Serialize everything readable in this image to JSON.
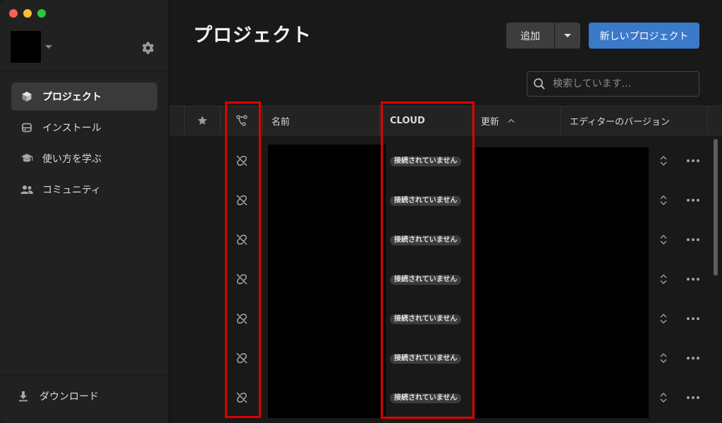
{
  "sidebar": {
    "settings_icon": "gear-icon",
    "nav": [
      {
        "label": "プロジェクト",
        "icon": "cube-icon",
        "active": true
      },
      {
        "label": "インストール",
        "icon": "installs-icon",
        "active": false
      },
      {
        "label": "使い方を学ぶ",
        "icon": "graduation-cap-icon",
        "active": false
      },
      {
        "label": "コミュニティ",
        "icon": "people-icon",
        "active": false
      }
    ],
    "download_label": "ダウンロード"
  },
  "main": {
    "title": "プロジェクト",
    "add_button": "追加",
    "new_project_button": "新しいプロジェクト",
    "search_placeholder": "検索しています...",
    "columns": {
      "name": "名前",
      "cloud": "CLOUD",
      "updated": "更新",
      "editor_version": "エディターのバージョン"
    },
    "rows": [
      {
        "cloud_status": "接続されていません"
      },
      {
        "cloud_status": "接続されていません"
      },
      {
        "cloud_status": "接続されていません"
      },
      {
        "cloud_status": "接続されていません"
      },
      {
        "cloud_status": "接続されていません"
      },
      {
        "cloud_status": "接続されていません"
      },
      {
        "cloud_status": "接続されていません"
      }
    ]
  },
  "colors": {
    "accent": "#3b79c9",
    "highlight": "#e00000",
    "background": "#191919",
    "sidebar": "#212121"
  }
}
